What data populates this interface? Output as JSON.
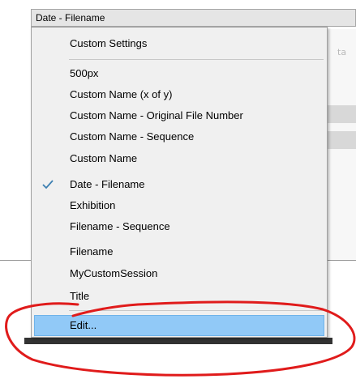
{
  "combo": {
    "selected_value": "Date - Filename"
  },
  "background": {
    "fragment_text": "ta"
  },
  "menu": {
    "items": [
      {
        "label": "Custom Settings",
        "checked": false,
        "highlighted": false
      },
      {
        "label": "500px",
        "checked": false,
        "highlighted": false
      },
      {
        "label": "Custom Name (x of y)",
        "checked": false,
        "highlighted": false
      },
      {
        "label": "Custom Name - Original File Number",
        "checked": false,
        "highlighted": false
      },
      {
        "label": "Custom Name - Sequence",
        "checked": false,
        "highlighted": false
      },
      {
        "label": "Custom Name",
        "checked": false,
        "highlighted": false
      },
      {
        "label": "Date - Filename",
        "checked": true,
        "highlighted": false
      },
      {
        "label": "Exhibition",
        "checked": false,
        "highlighted": false
      },
      {
        "label": "Filename - Sequence",
        "checked": false,
        "highlighted": false
      },
      {
        "label": "Filename",
        "checked": false,
        "highlighted": false
      },
      {
        "label": "MyCustomSession",
        "checked": false,
        "highlighted": false
      },
      {
        "label": "Title",
        "checked": false,
        "highlighted": false
      },
      {
        "label": "Edit...",
        "checked": false,
        "highlighted": true
      }
    ]
  },
  "colors": {
    "highlight": "#91c9f7",
    "check": "#3c7fb1",
    "annotation": "#e01b1b"
  },
  "icons": {
    "check": "checkmark-icon"
  }
}
